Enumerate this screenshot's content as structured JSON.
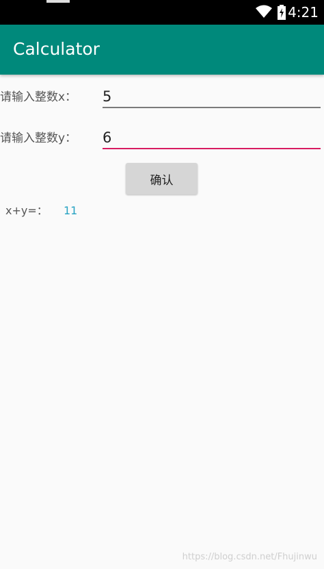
{
  "status_bar": {
    "time": "4:21",
    "icons": [
      "wifi-icon",
      "battery-icon"
    ]
  },
  "app_bar": {
    "title": "Calculator",
    "color": "#00897b"
  },
  "form": {
    "x_label": "请输入整数x：",
    "x_value": "5",
    "y_label": "请输入整数y：",
    "y_value": "6",
    "focused_underline_color": "#d81b60",
    "confirm_label": "确认"
  },
  "result": {
    "label": "x+y=：",
    "value": "11",
    "value_color": "#26a2c2"
  },
  "watermark": {
    "text": "https://blog.csdn.net/Fhujinwu"
  }
}
